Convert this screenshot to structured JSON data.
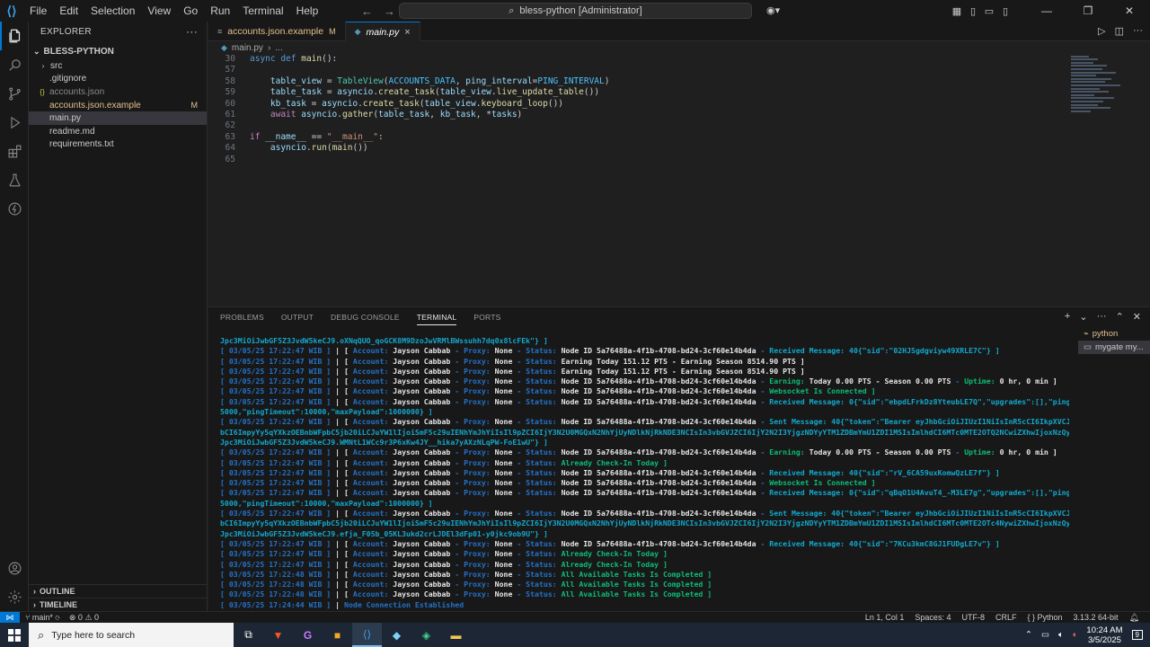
{
  "menu": [
    "File",
    "Edit",
    "Selection",
    "View",
    "Go",
    "Run",
    "Terminal",
    "Help"
  ],
  "command_center": "bless-python [Administrator]",
  "explorer": {
    "title": "EXPLORER",
    "folder": "BLESS-PYTHON",
    "items": [
      {
        "name": "src",
        "type": "folder"
      },
      {
        "name": ".gitignore",
        "type": "file"
      },
      {
        "name": "accounts.json",
        "type": "json"
      },
      {
        "name": "accounts.json.example",
        "type": "file",
        "badge": "M"
      },
      {
        "name": "main.py",
        "type": "py"
      },
      {
        "name": "readme.md",
        "type": "md"
      },
      {
        "name": "requirements.txt",
        "type": "txt"
      }
    ],
    "outline": "OUTLINE",
    "timeline": "TIMELINE"
  },
  "tabs": [
    {
      "label": "accounts.json.example",
      "badge": "M"
    },
    {
      "label": "main.py",
      "close": "×"
    }
  ],
  "breadcrumb": {
    "file": "main.py",
    "sep": "›",
    "rest": "..."
  },
  "code_lines": [
    {
      "n": "30",
      "segs": [
        [
          "kw",
          "async "
        ],
        [
          "kw",
          "def "
        ],
        [
          "fn",
          "main"
        ],
        [
          "",
          "():"
        ]
      ]
    },
    {
      "n": "57",
      "segs": []
    },
    {
      "n": "58",
      "segs": [
        [
          "",
          "    "
        ],
        [
          "var",
          "table_view"
        ],
        [
          "",
          " = "
        ],
        [
          "cls",
          "TableView"
        ],
        [
          "",
          "("
        ],
        [
          "cst",
          "ACCOUNTS_DATA"
        ],
        [
          "",
          ", "
        ],
        [
          "var",
          "ping_interval"
        ],
        [
          "",
          "="
        ],
        [
          "cst",
          "PING_INTERVAL"
        ],
        [
          "",
          ")"
        ]
      ]
    },
    {
      "n": "59",
      "segs": [
        [
          "",
          "    "
        ],
        [
          "var",
          "table_task"
        ],
        [
          "",
          " = "
        ],
        [
          "var",
          "asyncio"
        ],
        [
          "",
          "."
        ],
        [
          "fn",
          "create_task"
        ],
        [
          "",
          "("
        ],
        [
          "var",
          "table_view"
        ],
        [
          "",
          "."
        ],
        [
          "fn",
          "live_update_table"
        ],
        [
          "",
          "())"
        ]
      ]
    },
    {
      "n": "60",
      "segs": [
        [
          "",
          "    "
        ],
        [
          "var",
          "kb_task"
        ],
        [
          "",
          " = "
        ],
        [
          "var",
          "asyncio"
        ],
        [
          "",
          "."
        ],
        [
          "fn",
          "create_task"
        ],
        [
          "",
          "("
        ],
        [
          "var",
          "table_view"
        ],
        [
          "",
          "."
        ],
        [
          "fn",
          "keyboard_loop"
        ],
        [
          "",
          "())"
        ]
      ]
    },
    {
      "n": "61",
      "segs": [
        [
          "",
          "    "
        ],
        [
          "kw2",
          "await "
        ],
        [
          "var",
          "asyncio"
        ],
        [
          "",
          "."
        ],
        [
          "fn",
          "gather"
        ],
        [
          "",
          "("
        ],
        [
          "var",
          "table_task"
        ],
        [
          "",
          ", "
        ],
        [
          "var",
          "kb_task"
        ],
        [
          "",
          ", *"
        ],
        [
          "var",
          "tasks"
        ],
        [
          "",
          ")"
        ]
      ]
    },
    {
      "n": "62",
      "segs": []
    },
    {
      "n": "63",
      "segs": [
        [
          "kw2",
          "if "
        ],
        [
          "var",
          "__name__"
        ],
        [
          "",
          " == "
        ],
        [
          "str",
          "\"__main__\""
        ],
        [
          "",
          ":"
        ]
      ]
    },
    {
      "n": "64",
      "segs": [
        [
          "",
          "    "
        ],
        [
          "var",
          "asyncio"
        ],
        [
          "",
          "."
        ],
        [
          "fn",
          "run"
        ],
        [
          "",
          "("
        ],
        [
          "fn",
          "main"
        ],
        [
          "",
          "())"
        ]
      ]
    },
    {
      "n": "65",
      "segs": []
    }
  ],
  "panel_tabs": [
    "PROBLEMS",
    "OUTPUT",
    "DEBUG CONSOLE",
    "TERMINAL",
    "PORTS"
  ],
  "terminal_list": [
    {
      "label": "python"
    },
    {
      "label": "mygate my..."
    }
  ],
  "terminal_lines": [
    [
      [
        "c",
        "Jpc3MiOiJwbGF5Z3JvdW5keCJ9.oXNqQUO_qoGCK8M9DzoJwVRMlBWssuhh7dq0x8lcFEk\"} ]"
      ]
    ],
    [
      [
        "b",
        "[ 03/05/25 17:22:47 WIB ] "
      ],
      [
        "w",
        "| [ "
      ],
      [
        "b",
        "Account: "
      ],
      [
        "w",
        "Jayson Cabbab "
      ],
      [
        "b",
        "- Proxy: "
      ],
      [
        "w",
        "None "
      ],
      [
        "b",
        "- Status: "
      ],
      [
        "w",
        "Node ID 5a76488a-4f1b-4708-bd24-3cf60e14b4da "
      ],
      [
        "b",
        "- "
      ],
      [
        "c",
        "Received Message: 40{\"sid\":\"02HJSgdgviyw49XRLE7C\"} ]"
      ]
    ],
    [
      [
        "b",
        "[ 03/05/25 17:22:47 WIB ] "
      ],
      [
        "w",
        "| [ "
      ],
      [
        "b",
        "Account: "
      ],
      [
        "w",
        "Jayson Cabbab "
      ],
      [
        "b",
        "- Proxy: "
      ],
      [
        "w",
        "None "
      ],
      [
        "b",
        "- Status: "
      ],
      [
        "w",
        "Earning Today 151.12 PTS - Earning Season 8514.90 PTS ]"
      ]
    ],
    [
      [
        "b",
        "[ 03/05/25 17:22:47 WIB ] "
      ],
      [
        "w",
        "| [ "
      ],
      [
        "b",
        "Account: "
      ],
      [
        "w",
        "Jayson Cabbab "
      ],
      [
        "b",
        "- Proxy: "
      ],
      [
        "w",
        "None "
      ],
      [
        "b",
        "- Status: "
      ],
      [
        "w",
        "Earning Today 151.12 PTS - Earning Season 8514.90 PTS ]"
      ]
    ],
    [
      [
        "b",
        "[ 03/05/25 17:22:47 WIB ] "
      ],
      [
        "w",
        "| [ "
      ],
      [
        "b",
        "Account: "
      ],
      [
        "w",
        "Jayson Cabbab "
      ],
      [
        "b",
        "- Proxy: "
      ],
      [
        "w",
        "None "
      ],
      [
        "b",
        "- Status: "
      ],
      [
        "w",
        "Node ID 5a76488a-4f1b-4708-bd24-3cf60e14b4da "
      ],
      [
        "b",
        "- "
      ],
      [
        "g",
        "Earning: "
      ],
      [
        "w",
        "Today 0.00 PTS - Season 0.00 PTS "
      ],
      [
        "b",
        "- "
      ],
      [
        "g",
        "Uptime: "
      ],
      [
        "w",
        "0 hr, 0 min ]"
      ]
    ],
    [
      [
        "b",
        "[ 03/05/25 17:22:47 WIB ] "
      ],
      [
        "w",
        "| [ "
      ],
      [
        "b",
        "Account: "
      ],
      [
        "w",
        "Jayson Cabbab "
      ],
      [
        "b",
        "- Proxy: "
      ],
      [
        "w",
        "None "
      ],
      [
        "b",
        "- Status: "
      ],
      [
        "w",
        "Node ID 5a76488a-4f1b-4708-bd24-3cf60e14b4da "
      ],
      [
        "b",
        "- "
      ],
      [
        "g",
        "Websocket Is Connected ]"
      ]
    ],
    [
      [
        "b",
        "[ 03/05/25 17:22:47 WIB ] "
      ],
      [
        "w",
        "| [ "
      ],
      [
        "b",
        "Account: "
      ],
      [
        "w",
        "Jayson Cabbab "
      ],
      [
        "b",
        "- Proxy: "
      ],
      [
        "w",
        "None "
      ],
      [
        "b",
        "- Status: "
      ],
      [
        "w",
        "Node ID 5a76488a-4f1b-4708-bd24-3cf60e14b4da "
      ],
      [
        "b",
        "- "
      ],
      [
        "c",
        "Received Message: 0{\"sid\":\"ebpdLFrkDz8YteubLE7Q\",\"upgrades\":[],\"pingInterval\":"
      ]
    ],
    [
      [
        "c",
        "5000,\"pingTimeout\":10000,\"maxPayload\":1000000} ]"
      ]
    ],
    [
      [
        "b",
        "[ 03/05/25 17:22:47 WIB ] "
      ],
      [
        "w",
        "| [ "
      ],
      [
        "b",
        "Account: "
      ],
      [
        "w",
        "Jayson Cabbab "
      ],
      [
        "b",
        "- Proxy: "
      ],
      [
        "w",
        "None "
      ],
      [
        "b",
        "- Status: "
      ],
      [
        "w",
        "Node ID 5a76488a-4f1b-4708-bd24-3cf60e14b4da "
      ],
      [
        "b",
        "- "
      ],
      [
        "c",
        "Sent Message: 40{\"token\":\"Bearer eyJhbGciOiJIUzI1NiIsInR5cCI6IkpXVCJ9.eyJlbWFp"
      ]
    ],
    [
      [
        "c",
        "bCI6ImpyYy5qYXkzOEBnbWFpbC5jb20iLCJuYW1lIjoiSmF5c29uIENhYmJhYiIsIl9pZCI6IjY3N2U0MGQxN2NhYjUyNDlkNjRkNDE3NCIsIn3vbGVJZCI6IjY2N2I3YjgzNDYyYTM1ZDBmYmU1ZDI1MSIsImlhdCI6MTc0MTE2OTQ2NCwiZXhwIjoxNzQyMDMzNDY0LC"
      ]
    ],
    [
      [
        "c",
        "Jpc3MiOiJwbGF5Z3JvdW5keCJ9.WMNtL1WCc9r3P6xKw4JY__hika7yAXzNLqPW-FoE1wU\"} ]"
      ]
    ],
    [
      [
        "b",
        "[ 03/05/25 17:22:47 WIB ] "
      ],
      [
        "w",
        "| [ "
      ],
      [
        "b",
        "Account: "
      ],
      [
        "w",
        "Jayson Cabbab "
      ],
      [
        "b",
        "- Proxy: "
      ],
      [
        "w",
        "None "
      ],
      [
        "b",
        "- Status: "
      ],
      [
        "w",
        "Node ID 5a76488a-4f1b-4708-bd24-3cf60e14b4da "
      ],
      [
        "b",
        "- "
      ],
      [
        "g",
        "Earning: "
      ],
      [
        "w",
        "Today 0.00 PTS - Season 0.00 PTS "
      ],
      [
        "b",
        "- "
      ],
      [
        "g",
        "Uptime: "
      ],
      [
        "w",
        "0 hr, 0 min ]"
      ]
    ],
    [
      [
        "b",
        "[ 03/05/25 17:22:47 WIB ] "
      ],
      [
        "w",
        "| [ "
      ],
      [
        "b",
        "Account: "
      ],
      [
        "w",
        "Jayson Cabbab "
      ],
      [
        "b",
        "- Proxy: "
      ],
      [
        "w",
        "None "
      ],
      [
        "b",
        "- Status: "
      ],
      [
        "g",
        "Already Check-In Today ]"
      ]
    ],
    [
      [
        "b",
        "[ 03/05/25 17:22:47 WIB ] "
      ],
      [
        "w",
        "| [ "
      ],
      [
        "b",
        "Account: "
      ],
      [
        "w",
        "Jayson Cabbab "
      ],
      [
        "b",
        "- Proxy: "
      ],
      [
        "w",
        "None "
      ],
      [
        "b",
        "- Status: "
      ],
      [
        "w",
        "Node ID 5a76488a-4f1b-4708-bd24-3cf60e14b4da "
      ],
      [
        "b",
        "- "
      ],
      [
        "c",
        "Received Message: 40{\"sid\":\"rV_6CA59uxKomwQzLE7f\"} ]"
      ]
    ],
    [
      [
        "b",
        "[ 03/05/25 17:22:47 WIB ] "
      ],
      [
        "w",
        "| [ "
      ],
      [
        "b",
        "Account: "
      ],
      [
        "w",
        "Jayson Cabbab "
      ],
      [
        "b",
        "- Proxy: "
      ],
      [
        "w",
        "None "
      ],
      [
        "b",
        "- Status: "
      ],
      [
        "w",
        "Node ID 5a76488a-4f1b-4708-bd24-3cf60e14b4da "
      ],
      [
        "b",
        "- "
      ],
      [
        "g",
        "Websocket Is Connected ]"
      ]
    ],
    [
      [
        "b",
        "[ 03/05/25 17:22:47 WIB ] "
      ],
      [
        "w",
        "| [ "
      ],
      [
        "b",
        "Account: "
      ],
      [
        "w",
        "Jayson Cabbab "
      ],
      [
        "b",
        "- Proxy: "
      ],
      [
        "w",
        "None "
      ],
      [
        "b",
        "- Status: "
      ],
      [
        "w",
        "Node ID 5a76488a-4f1b-4708-bd24-3cf60e14b4da "
      ],
      [
        "b",
        "- "
      ],
      [
        "c",
        "Received Message: 0{\"sid\":\"qBqO1U4AvuT4_-M3LE7g\",\"upgrades\":[],\"pingInterval\":"
      ]
    ],
    [
      [
        "c",
        "5000,\"pingTimeout\":10000,\"maxPayload\":1000000} ]"
      ]
    ],
    [
      [
        "b",
        "[ 03/05/25 17:22:47 WIB ] "
      ],
      [
        "w",
        "| [ "
      ],
      [
        "b",
        "Account: "
      ],
      [
        "w",
        "Jayson Cabbab "
      ],
      [
        "b",
        "- Proxy: "
      ],
      [
        "w",
        "None "
      ],
      [
        "b",
        "- Status: "
      ],
      [
        "w",
        "Node ID 5a76488a-4f1b-4708-bd24-3cf60e14b4da "
      ],
      [
        "b",
        "- "
      ],
      [
        "c",
        "Sent Message: 40{\"token\":\"Bearer eyJhbGciOiJIUzI1NiIsInR5cCI6IkpXVCJ9.eyJlbWFp"
      ]
    ],
    [
      [
        "c",
        "bCI6ImpyYy5qYXkzOEBnbWFpbC5jb20iLCJuYW1lIjoiSmF5c29uIENhYmJhYiIsIl9pZCI6IjY3N2U0MGQxN2NhYjUyNDlkNjRkNDE3NCIsIn3vbGVJZCI6IjY2N2I3YjgzNDYyYTM1ZDBmYmU1ZDI1MSIsImlhdCI6MTc0MTE2OTc4NywiZXhwIjoxNzQyMDMzNzg3LC"
      ]
    ],
    [
      [
        "c",
        "Jpc3MiOiJwbGF5Z3JvdW5keCJ9.efja_F05b_05KL3ukd2crLJDEl3dFp01-y0jkc9ob9U\"} ]"
      ]
    ],
    [
      [
        "b",
        "[ 03/05/25 17:22:47 WIB ] "
      ],
      [
        "w",
        "| [ "
      ],
      [
        "b",
        "Account: "
      ],
      [
        "w",
        "Jayson Cabbab "
      ],
      [
        "b",
        "- Proxy: "
      ],
      [
        "w",
        "None "
      ],
      [
        "b",
        "- Status: "
      ],
      [
        "w",
        "Node ID 5a76488a-4f1b-4708-bd24-3cf60e14b4da "
      ],
      [
        "b",
        "- "
      ],
      [
        "c",
        "Received Message: 40{\"sid\":\"7KCu3kmC8GJ1FUDgLE7v\"} ]"
      ]
    ],
    [
      [
        "b",
        "[ 03/05/25 17:22:47 WIB ] "
      ],
      [
        "w",
        "| [ "
      ],
      [
        "b",
        "Account: "
      ],
      [
        "w",
        "Jayson Cabbab "
      ],
      [
        "b",
        "- Proxy: "
      ],
      [
        "w",
        "None "
      ],
      [
        "b",
        "- Status: "
      ],
      [
        "g",
        "Already Check-In Today ]"
      ]
    ],
    [
      [
        "b",
        "[ 03/05/25 17:22:47 WIB ] "
      ],
      [
        "w",
        "| [ "
      ],
      [
        "b",
        "Account: "
      ],
      [
        "w",
        "Jayson Cabbab "
      ],
      [
        "b",
        "- Proxy: "
      ],
      [
        "w",
        "None "
      ],
      [
        "b",
        "- Status: "
      ],
      [
        "g",
        "Already Check-In Today ]"
      ]
    ],
    [
      [
        "b",
        "[ 03/05/25 17:22:48 WIB ] "
      ],
      [
        "w",
        "| [ "
      ],
      [
        "b",
        "Account: "
      ],
      [
        "w",
        "Jayson Cabbab "
      ],
      [
        "b",
        "- Proxy: "
      ],
      [
        "w",
        "None "
      ],
      [
        "b",
        "- Status: "
      ],
      [
        "g",
        "All Available Tasks Is Completed ]"
      ]
    ],
    [
      [
        "b",
        "[ 03/05/25 17:22:48 WIB ] "
      ],
      [
        "w",
        "| [ "
      ],
      [
        "b",
        "Account: "
      ],
      [
        "w",
        "Jayson Cabbab "
      ],
      [
        "b",
        "- Proxy: "
      ],
      [
        "w",
        "None "
      ],
      [
        "b",
        "- Status: "
      ],
      [
        "g",
        "All Available Tasks Is Completed ]"
      ]
    ],
    [
      [
        "b",
        "[ 03/05/25 17:22:48 WIB ] "
      ],
      [
        "w",
        "| [ "
      ],
      [
        "b",
        "Account: "
      ],
      [
        "w",
        "Jayson Cabbab "
      ],
      [
        "b",
        "- Proxy: "
      ],
      [
        "w",
        "None "
      ],
      [
        "b",
        "- Status: "
      ],
      [
        "g",
        "All Available Tasks Is Completed ]"
      ]
    ],
    [
      [
        "b",
        "[ 03/05/25 17:24:44 WIB ] "
      ],
      [
        "w",
        "| "
      ],
      [
        "b",
        "Node Connection Established"
      ]
    ]
  ],
  "status": {
    "branch": "main*",
    "errors": "0",
    "warnings": "0",
    "position": "Ln 1, Col 1",
    "spaces": "Spaces: 4",
    "encoding": "UTF-8",
    "eol": "CRLF",
    "language": "Python",
    "interpreter": "3.13.2 64-bit"
  },
  "taskbar": {
    "search_placeholder": "Type here to search",
    "time": "10:24 AM",
    "date": "3/5/2025",
    "notifications": "9"
  },
  "colors": {
    "accent": "#0078d4",
    "editor_bg": "#1f1f1f",
    "sidebar_bg": "#181818"
  }
}
